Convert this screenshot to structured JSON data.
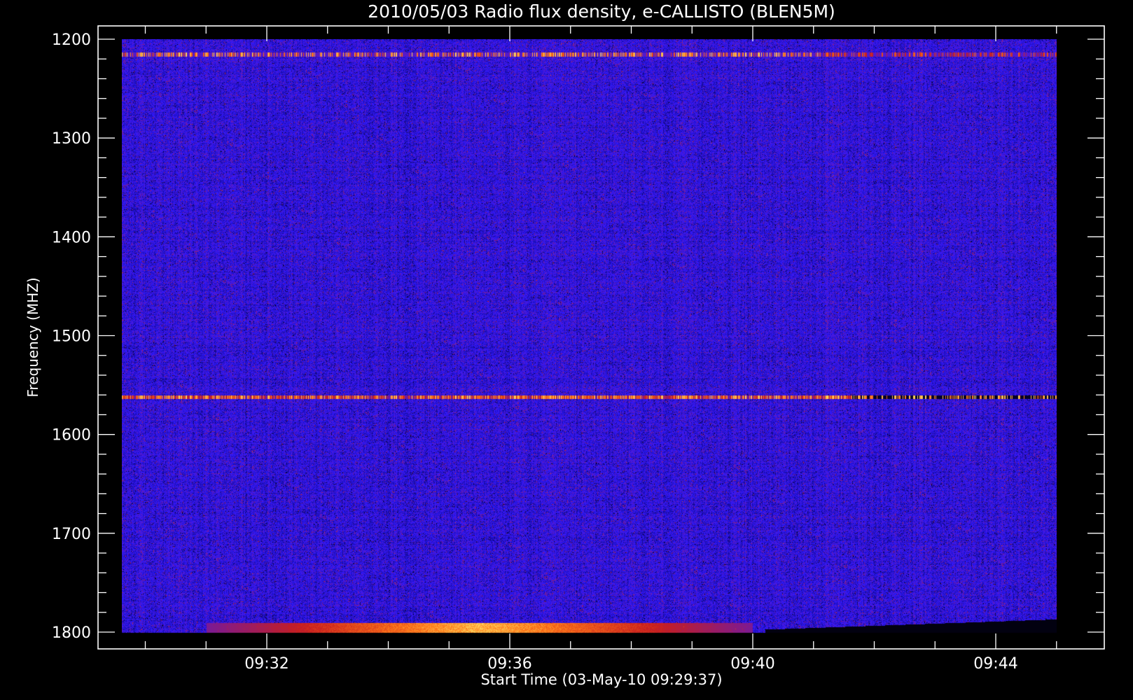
{
  "chart_data": {
    "type": "heatmap",
    "title": "2010/05/03  Radio flux density, e-CALLISTO (BLEN5M)",
    "xlabel": "Start Time (03-May-10 09:29:37)",
    "ylabel": "Frequency (MHZ)",
    "y_axis": {
      "range": [
        1200,
        1800
      ],
      "inverted": true,
      "ticks": [
        1200,
        1300,
        1400,
        1500,
        1600,
        1700,
        1800
      ],
      "tick_labels": [
        "1200",
        "1300",
        "1400",
        "1500",
        "1600",
        "1700",
        "1800"
      ]
    },
    "x_axis": {
      "range_minutes": [
        29.617,
        45.0
      ],
      "ticks_minutes": [
        32,
        36,
        40,
        44
      ],
      "tick_labels": [
        "09:32",
        "09:36",
        "09:40",
        "09:44"
      ]
    },
    "colormap": [
      "#000000",
      "#1a0aa0",
      "#2e1aff",
      "#7a1aa8",
      "#c81e1e",
      "#ff7a1a",
      "#ffe066"
    ],
    "background": "#000000",
    "features": [
      {
        "kind": "band",
        "freq_mhz": 1215,
        "intensity": "high",
        "t_start_min": 29.62,
        "t_end_min": 45.0
      },
      {
        "kind": "band",
        "freq_mhz": 1562,
        "intensity": "high",
        "t_start_min": 29.62,
        "t_end_min": 45.0
      },
      {
        "kind": "emission",
        "freq_mhz": 1795,
        "intensity": "high",
        "t_start_min": 31.0,
        "t_end_min": 40.0
      }
    ]
  }
}
